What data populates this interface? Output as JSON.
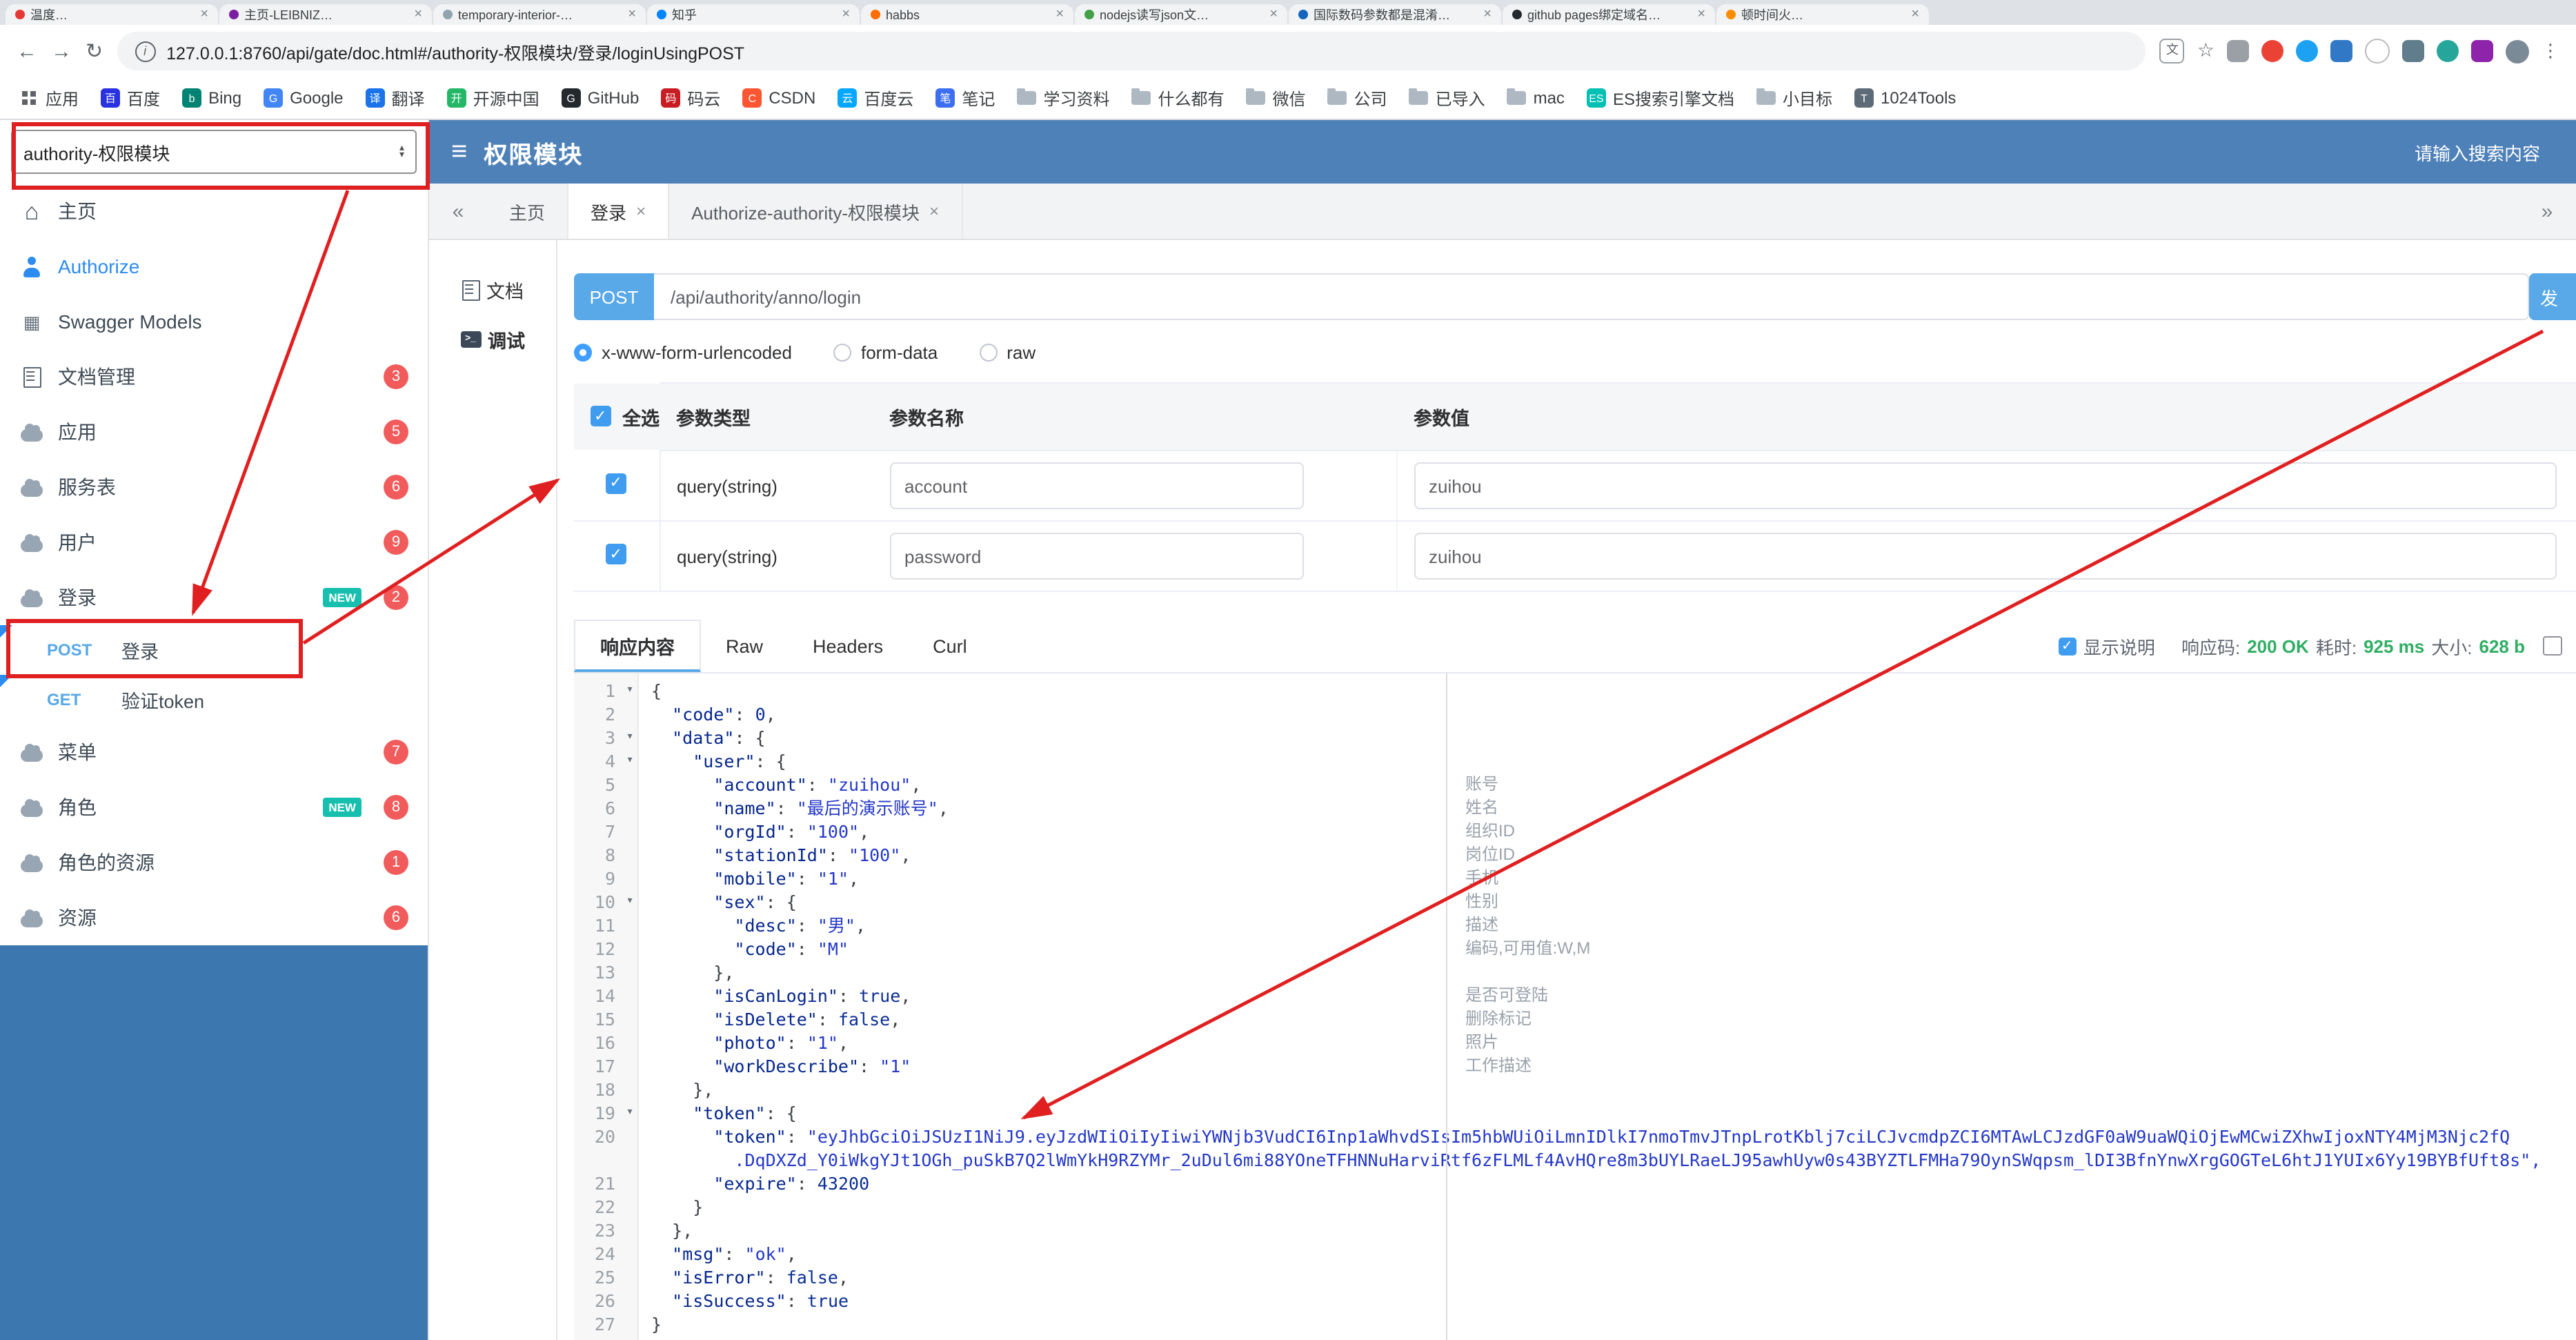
{
  "browser": {
    "tabs": [
      {
        "title": "温度…",
        "fav": "#e53935"
      },
      {
        "title": "主页-LEIBNIZ…",
        "fav": "#7b1fa2"
      },
      {
        "title": "temporary-interior-…",
        "fav": "#90a4ae"
      },
      {
        "title": "知乎",
        "fav": "#0084ff"
      },
      {
        "title": "habbs",
        "fav": "#ff6d00"
      },
      {
        "title": "nodejs读写json文…",
        "fav": "#43a047"
      },
      {
        "title": "国际数码参数都是混淆…",
        "fav": "#1565c0"
      },
      {
        "title": "github pages绑定域名…",
        "fav": "#24292e"
      },
      {
        "title": "顿时间火…",
        "fav": "#fb8c00"
      }
    ],
    "url": "127.0.0.1:8760/api/gate/doc.html#/authority-权限模块/登录/loginUsingPOST",
    "bookmarks": [
      {
        "label": "应用",
        "type": "apps"
      },
      {
        "label": "百度",
        "type": "site",
        "glyph": "百",
        "bg": "#2932e1"
      },
      {
        "label": "Bing",
        "type": "site",
        "glyph": "b",
        "bg": "#008373"
      },
      {
        "label": "Google",
        "type": "site",
        "glyph": "G",
        "bg": "#4285f4"
      },
      {
        "label": "翻译",
        "type": "site",
        "glyph": "译",
        "bg": "#1a73e8"
      },
      {
        "label": "开源中国",
        "type": "site",
        "glyph": "开",
        "bg": "#24b768"
      },
      {
        "label": "GitHub",
        "type": "site",
        "glyph": "G",
        "bg": "#24292e"
      },
      {
        "label": "码云",
        "type": "site",
        "glyph": "码",
        "bg": "#c71d23"
      },
      {
        "label": "CSDN",
        "type": "site",
        "glyph": "C",
        "bg": "#fc5531"
      },
      {
        "label": "百度云",
        "type": "site",
        "glyph": "云",
        "bg": "#06a7ff"
      },
      {
        "label": "笔记",
        "type": "site",
        "glyph": "笔",
        "bg": "#3b6ef0"
      },
      {
        "label": "学习资料",
        "type": "folder"
      },
      {
        "label": "什么都有",
        "type": "folder"
      },
      {
        "label": "微信",
        "type": "folder"
      },
      {
        "label": "公司",
        "type": "folder"
      },
      {
        "label": "已导入",
        "type": "folder"
      },
      {
        "label": "mac",
        "type": "folder"
      },
      {
        "label": "ES搜索引擎文档",
        "type": "site",
        "glyph": "ES",
        "bg": "#00bfb3"
      },
      {
        "label": "小目标",
        "type": "folder"
      },
      {
        "label": "1024Tools",
        "type": "site",
        "glyph": "T",
        "bg": "#5c6b77"
      }
    ]
  },
  "sidebar": {
    "group_select": "authority-权限模块",
    "new_label": "NEW",
    "items": [
      {
        "label": "主页"
      },
      {
        "label": "Authorize"
      },
      {
        "label": "Swagger Models"
      },
      {
        "label": "文档管理",
        "badge": "3"
      },
      {
        "label": "应用",
        "badge": "5"
      },
      {
        "label": "服务表",
        "badge": "6"
      },
      {
        "label": "用户",
        "badge": "9"
      },
      {
        "label": "登录",
        "badge": "2"
      },
      {
        "label": "登录",
        "method": "POST"
      },
      {
        "label": "验证token",
        "method": "GET"
      },
      {
        "label": "菜单",
        "badge": "7"
      },
      {
        "label": "角色",
        "badge": "8"
      },
      {
        "label": "角色的资源",
        "badge": "1"
      },
      {
        "label": "资源",
        "badge": "6"
      }
    ]
  },
  "header": {
    "title": "权限模块",
    "search_placeholder": "请输入搜索内容"
  },
  "doc_tabs": {
    "items": [
      {
        "label": "主页"
      },
      {
        "label": "登录"
      },
      {
        "label": "Authorize-authority-权限模块"
      }
    ]
  },
  "side_tabs": {
    "doc": "文档",
    "debug": "调试"
  },
  "request": {
    "method": "POST",
    "url": "/api/authority/anno/login",
    "send_label": "发",
    "content_types": [
      "x-www-form-urlencoded",
      "form-data",
      "raw"
    ]
  },
  "params_table": {
    "select_all": "全选",
    "col_type": "参数类型",
    "col_name": "参数名称",
    "col_value": "参数值",
    "rows": [
      {
        "type": "query(string)",
        "name": "account",
        "value": "zuihou"
      },
      {
        "type": "query(string)",
        "name": "password",
        "value": "zuihou"
      }
    ]
  },
  "response": {
    "tabs": [
      "响应内容",
      "Raw",
      "Headers",
      "Curl"
    ],
    "show_desc": "显示说明",
    "code_label": "响应码:",
    "code": "200 OK",
    "time_label": "耗时:",
    "time": "925 ms",
    "size_label": "大小:",
    "size": "628 b"
  },
  "editor": {
    "lines": [
      {
        "n": "1",
        "t": "{",
        "f": true
      },
      {
        "n": "2",
        "t": "  \"code\": 0,"
      },
      {
        "n": "3",
        "t": "  \"data\": {",
        "f": true
      },
      {
        "n": "4",
        "t": "    \"user\": {",
        "f": true
      },
      {
        "n": "5",
        "t": "      \"account\": \"zuihou\",",
        "c": "账号"
      },
      {
        "n": "6",
        "t": "      \"name\": \"最后的演示账号\",",
        "c": "姓名"
      },
      {
        "n": "7",
        "t": "      \"orgId\": \"100\",",
        "c": "组织ID"
      },
      {
        "n": "8",
        "t": "      \"stationId\": \"100\",",
        "c": "岗位ID"
      },
      {
        "n": "9",
        "t": "      \"mobile\": \"1\",",
        "c": "手机"
      },
      {
        "n": "10",
        "t": "      \"sex\": {",
        "f": true,
        "c": "性别"
      },
      {
        "n": "11",
        "t": "        \"desc\": \"男\",",
        "c": "描述"
      },
      {
        "n": "12",
        "t": "        \"code\": \"M\"",
        "c": "编码,可用值:W,M"
      },
      {
        "n": "13",
        "t": "      },"
      },
      {
        "n": "14",
        "t": "      \"isCanLogin\": true,",
        "c": "是否可登陆"
      },
      {
        "n": "15",
        "t": "      \"isDelete\": false,",
        "c": "删除标记"
      },
      {
        "n": "16",
        "t": "      \"photo\": \"1\",",
        "c": "照片"
      },
      {
        "n": "17",
        "t": "      \"workDescribe\": \"1\"",
        "c": "工作描述"
      },
      {
        "n": "18",
        "t": "    },"
      },
      {
        "n": "19",
        "t": "    \"token\": {",
        "f": true
      },
      {
        "n": "20",
        "t": "      \"token\": \"eyJhbGciOiJSUzI1NiJ9.eyJzdWIiOiIyIiwiYWNjb3VudCI6Inp1aWhvdSIsIm5hbWUiOiLmnIDlkI7nmoTmvJTnpLrotKblj7ciLCJvcmdpZCI6MTAwLCJzdGF0aW9uaWQiOjEwMCwiZXhwIjoxNTY4MjM3Njc2fQ"
      },
      {
        "n": "",
        "t": "        .DqDXZd_Y0iWkgYJt1OGh_puSkB7Q2lWmYkH9RZYMr_2uDul6mi88YOneTFHNNuHarviRtf6zFLMLf4AvHQre8m3bUYLRaeLJ95awhUyw0s43BYZTLFMHa79OynSWqpsm_lDI3BfnYnwXrgGOGTeL6htJ1YUIx6Yy19BYBfUft8s\",",
        "cls": "str"
      },
      {
        "n": "21",
        "t": "      \"expire\": 43200"
      },
      {
        "n": "22",
        "t": "    }"
      },
      {
        "n": "23",
        "t": "  },"
      },
      {
        "n": "24",
        "t": "  \"msg\": \"ok\","
      },
      {
        "n": "25",
        "t": "  \"isError\": false,"
      },
      {
        "n": "26",
        "t": "  \"isSuccess\": true"
      },
      {
        "n": "27",
        "t": "}"
      }
    ]
  }
}
